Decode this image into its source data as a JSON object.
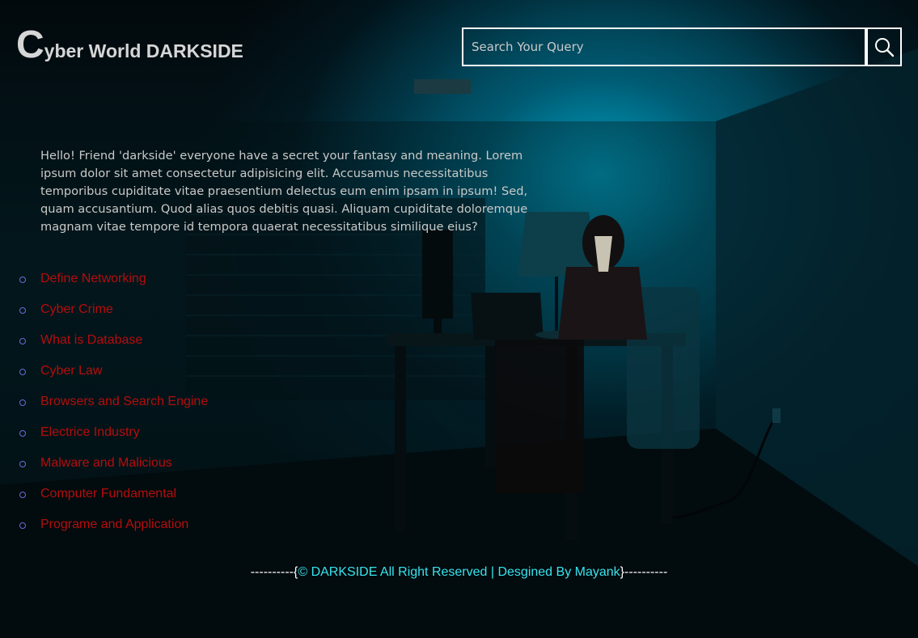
{
  "logo": {
    "initial": "C",
    "rest": "yber World DARKSIDE"
  },
  "search": {
    "placeholder": "Search Your Query",
    "value": "",
    "button_icon": "search-icon"
  },
  "intro": {
    "text": "Hello! Friend 'darkside' everyone have a secret your fantasy and meaning. Lorem ipsum dolor sit amet consectetur adipisicing elit. Accusamus necessitatibus temporibus cupiditate vitae praesentium delectus eum enim ipsam in ipsum! Sed, quam accusantium. Quod alias quos debitis quasi. Aliquam cupiditate doloremque magnam vitae tempore id tempora quaerat necessitatibus similique eius?"
  },
  "topics": [
    {
      "label": "Define Networking"
    },
    {
      "label": "Cyber Crime"
    },
    {
      "label": "What is Database"
    },
    {
      "label": "Cyber Law"
    },
    {
      "label": "Browsers and Search Engine"
    },
    {
      "label": "Electrice Industry"
    },
    {
      "label": "Malware and Malicious"
    },
    {
      "label": "Computer Fundamental"
    },
    {
      "label": "Programe and Application"
    }
  ],
  "footer": {
    "left_dashes": "----------{",
    "text": "© DARKSIDE All Right Reserved | Desgined By Mayank",
    "right_dashes": "}----------"
  },
  "colors": {
    "link": "#b50d0d",
    "footer_accent": "#38e3ee",
    "bullet": "#6b6bd8",
    "logo": "#d6d6d6"
  }
}
